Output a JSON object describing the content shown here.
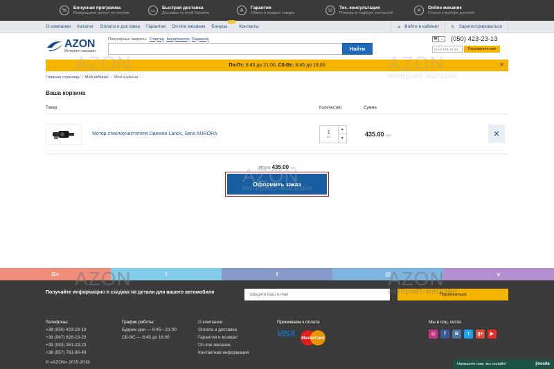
{
  "benefits": [
    {
      "title": "Бонусная программа",
      "sub": "Возвращаем деньги за покупки",
      "icon": "percent-icon"
    },
    {
      "title": "Быстрая доставка",
      "sub": "Доставка по всей Украине",
      "icon": "truck-icon"
    },
    {
      "title": "Гарантия",
      "sub": "Обмен и возврат товара",
      "icon": "shield-icon"
    },
    {
      "title": "Тех. консультация",
      "sub": "Помощь в подборе запчастей",
      "icon": "headset-icon"
    },
    {
      "title": "Online механик",
      "sub": "Статьи о выборе деталей",
      "icon": "wrench-icon"
    }
  ],
  "nav": {
    "links": [
      "О компании",
      "Каталог",
      "Оплата и доставка",
      "Гарантия",
      "On-line механик",
      "Бонусы",
      "Контакты"
    ],
    "new_badge": "new",
    "login": "Войти в кабинет",
    "register": "Зарегистрироваться"
  },
  "header": {
    "logo_name": "AZON",
    "logo_sub": "Интернет-магазин",
    "popular_label": "Популярные запросы:",
    "popular": [
      "Стартер",
      "Амортизатор",
      "Радиатор"
    ],
    "search_button": "Найти",
    "phone": "(050) 423-23-13",
    "callback_placeholder": "(XXX) XXX-XX-XX",
    "callback_button": "Перезвоните мне"
  },
  "schedule": {
    "days1": "Пн-Пт:",
    "hours1": "8:45 до 21:00,",
    "days2": "Сб-Вс:",
    "hours2": "8:45 до 18:00"
  },
  "breadcrumb": [
    "Главная страница",
    "Мой кабинет",
    "Моя корзина"
  ],
  "page_title": "Ваша корзина",
  "cart": {
    "col_product": "Товар",
    "col_qty": "Количество",
    "col_sum": "Сумма",
    "items": [
      {
        "name": "Мотор стеклоочистителя Daewoo Lanos, Sens AURORA",
        "qty": "1",
        "unit": "шт",
        "sum": "435.00",
        "currency": "грн"
      }
    ],
    "total_label": "Итого",
    "total": "435.00",
    "currency": "грн",
    "checkout": "Оформить заказ"
  },
  "social_strip": [
    {
      "label": "G+",
      "color": "#f08d7a"
    },
    {
      "label": "t",
      "color": "#84cdea"
    },
    {
      "label": "f",
      "color": "#8799c6"
    },
    {
      "label": "@",
      "color": "#7db5e0"
    },
    {
      "label": "v",
      "color": "#b48ed0"
    }
  ],
  "footer": {
    "subscribe_text": "Получайте информацию о скидках на детали для вашего автомобиля",
    "email_placeholder": "Введите Ваш e-mail",
    "subscribe_button": "Подписаться",
    "phones_title": "Телефоны:",
    "phones": [
      "+38 (050) 423-23-13",
      "+38 (067) 628-23-23",
      "+38 (093) 351-23-23",
      "+38 (057) 761-30-43"
    ],
    "schedule_title": "График работы:",
    "schedule": [
      "Будние дни — 8:45—21:00",
      "СБ-ВС — 8:45 до 18:00"
    ],
    "links": [
      "О компании",
      "Оплата и доставка",
      "Гарантия и возврат",
      "On-line механик",
      "Контактная информация"
    ],
    "pay_title": "Принимаем к оплате",
    "visa": "VISA",
    "mastercard": "MasterCard",
    "soc_title": "Мы в соц. сетях",
    "soc": [
      {
        "label": "◎",
        "color": "#c13584"
      },
      {
        "label": "f",
        "color": "#3b5998"
      },
      {
        "label": "B",
        "color": "#4c75a3"
      },
      {
        "label": "t",
        "color": "#1da1f2"
      },
      {
        "label": "g+",
        "color": "#dd4b39"
      },
      {
        "label": "▶",
        "color": "#e52d27"
      }
    ],
    "copyright": "© «AZON» 2015-2018",
    "chat_text": "Напишите нам, мы онлайн!",
    "chat_brand": "jivosite"
  },
  "watermark": {
    "name": "AZON",
    "sub": "интернет-магазин"
  },
  "colors": {
    "brand_blue": "#1e6ab8",
    "accent_yellow": "#f5b400",
    "footer_bg": "#3b3b3b"
  }
}
